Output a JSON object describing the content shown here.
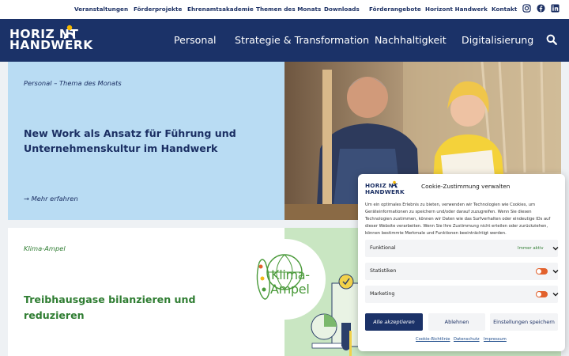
{
  "topnav": {
    "items": [
      "Veranstaltungen",
      "Förderprojekte",
      "Ehrenamtsakademie",
      "Themen des Monats",
      "Downloads",
      "Förderangebote",
      "Horizont Handwerk",
      "Kontakt"
    ],
    "social_icons": [
      "instagram-icon",
      "facebook-icon",
      "linkedin-icon"
    ]
  },
  "header": {
    "logo_line1": "HORIZ NT",
    "logo_line2": "HANDWERK",
    "nav": [
      "Personal",
      "Strategie & Transformation",
      "Nachhaltigkeit",
      "Digitalisierung"
    ],
    "search_icon": "search-icon",
    "colors": {
      "navy": "#1b3268",
      "accent_yellow": "#f5b800"
    }
  },
  "cards": [
    {
      "kicker": "Personal – Thema des Monats",
      "title": "New Work als Ansatz für Führung und Unternehmenskultur im Handwerk",
      "link": "→ Mehr erfahren",
      "bg_color": "#b9dcf3"
    },
    {
      "kicker": "Klima-Ampel",
      "title": "Treibhausgase bilanzieren und reduzieren",
      "badge_line1": "Klima-",
      "badge_line2": "Ampel",
      "accent_color": "#2f7d32"
    }
  ],
  "cookie": {
    "logo_line1": "HORIZ NT",
    "logo_line2": "HANDWERK",
    "title": "Cookie-Zustimmung verwalten",
    "text": "Um ein optimales Erlebnis zu bieten, verwenden wir Technologien wie Cookies, um Geräteinformationen zu speichern und/oder darauf zuzugreifen. Wenn Sie diesen Technologien zustimmen, können wir Daten wie das Surfverhalten oder eindeutige IDs auf dieser Website verarbeiten. Wenn Sie Ihre Zustimmung nicht erteilen oder zurückziehen, können bestimmte Merkmale und Funktionen beeinträchtigt werden.",
    "rows": [
      {
        "label": "Funktional",
        "status": "Immer aktiv"
      },
      {
        "label": "Statistiken",
        "status": ""
      },
      {
        "label": "Marketing",
        "status": ""
      }
    ],
    "buttons": {
      "accept": "Alle akzeptieren",
      "deny": "Ablehnen",
      "settings": "Einstellungen speichern"
    },
    "links": [
      "Cookie-Richtlinie",
      "Datenschutz",
      "Impressum"
    ],
    "toggle_color": "#e2612c"
  }
}
